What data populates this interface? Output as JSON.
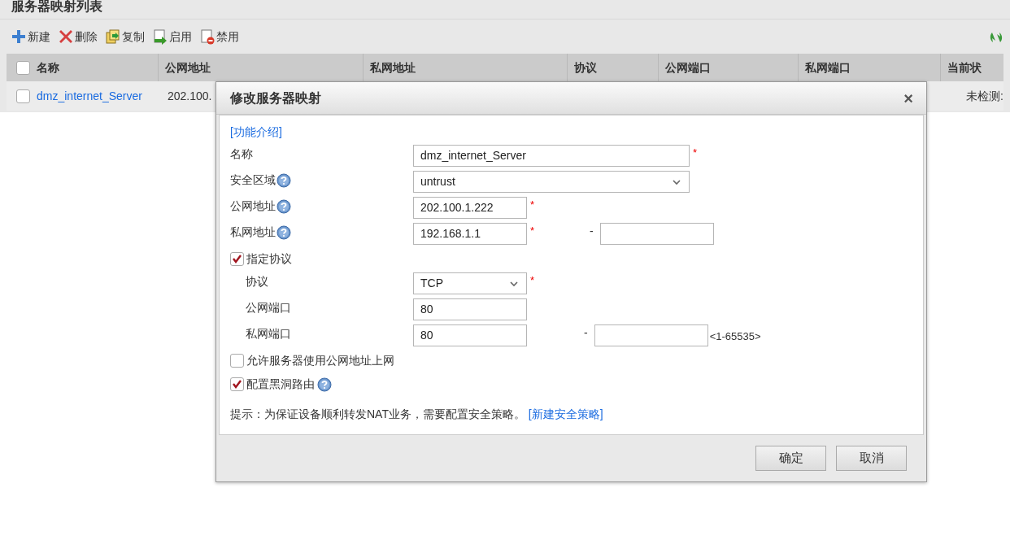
{
  "page": {
    "title": "服务器映射列表"
  },
  "toolbar": [
    {
      "kind": "add",
      "label": "新建"
    },
    {
      "kind": "delete",
      "label": "删除"
    },
    {
      "kind": "copy",
      "label": "复制"
    },
    {
      "kind": "enable",
      "label": "启用"
    },
    {
      "kind": "disable",
      "label": "禁用"
    }
  ],
  "table": {
    "header_checked": false,
    "columns": [
      {
        "label": "名称"
      },
      {
        "label": "公网地址"
      },
      {
        "label": "私网地址"
      },
      {
        "label": "协议"
      },
      {
        "label": "公网端口"
      },
      {
        "label": "私网端口"
      },
      {
        "label": "当前状"
      }
    ],
    "rows": [
      {
        "checked": false,
        "name": "dmz_internet_Server",
        "public_address": "202.100.",
        "status": "未检测:"
      }
    ]
  },
  "dialog": {
    "title": "修改服务器映射",
    "close": "×",
    "intro_link": "[功能介绍]",
    "fields": [
      {
        "kind": "long-text",
        "label": "名称",
        "value": "dmz_internet_Server",
        "required": "*"
      },
      {
        "kind": "long-select",
        "label": "安全区域",
        "help": true,
        "value": "untrust"
      },
      {
        "kind": "text",
        "label": "公网地址",
        "help": true,
        "value": "202.100.1.222",
        "required": "*"
      },
      {
        "kind": "range",
        "label": "私网地址",
        "help": true,
        "value": "192.168.1.1",
        "required": "*",
        "separator": "-"
      },
      {
        "kind": "checkbox",
        "label": "指定协议",
        "checked": true,
        "children": [
          {
            "kind": "select",
            "label": "协议",
            "value": "TCP",
            "required": "*"
          },
          {
            "kind": "text",
            "label": "公网端口",
            "value": "80"
          },
          {
            "kind": "range",
            "label": "私网端口",
            "value": "80",
            "separator": "-",
            "hint": "<1-65535>"
          }
        ]
      },
      {
        "kind": "checkbox",
        "label": "允许服务器使用公网地址上网",
        "checked": false
      },
      {
        "kind": "checkbox",
        "label": "配置黑洞路由",
        "checked": true,
        "help": true
      }
    ],
    "note": "提示：为保证设备顺利转发NAT业务，需要配置安全策略。",
    "note_link": "[新建安全策略]",
    "buttons": [
      "确定",
      "取消"
    ]
  }
}
